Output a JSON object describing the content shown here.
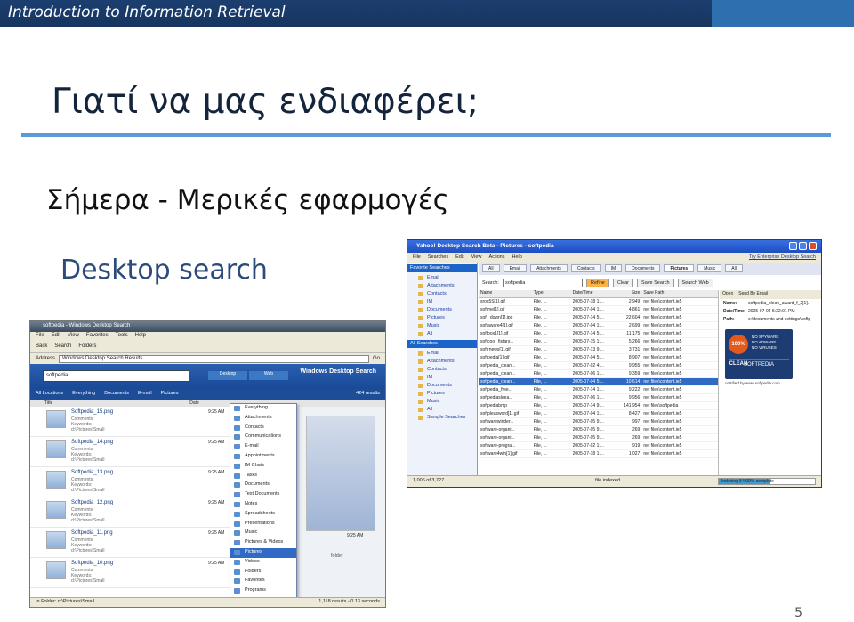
{
  "header": {
    "course_title": "Introduction to Information Retrieval"
  },
  "slide": {
    "title": "Γιατί να μας ενδιαφέρει;",
    "bullet1": "Σήμερα - Μερικές εφαρμογές",
    "bullet2": "Desktop search",
    "page_number": "5"
  },
  "windows_desktop_search": {
    "window_title": "softpedia - Windows Desktop Search",
    "menu": [
      "File",
      "Edit",
      "View",
      "Favorites",
      "Tools",
      "Help"
    ],
    "toolbar": [
      "Back",
      "Search",
      "Folders"
    ],
    "address_label": "Address",
    "address_value": "Windows Desktop Search Results",
    "address_go": "Go",
    "query": "softpedia",
    "scope_buttons": [
      "Desktop",
      "Web"
    ],
    "logo": "Windows Desktop Search",
    "filters": [
      "All Locations",
      "Everything",
      "Documents",
      "E-mail",
      "Pictures"
    ],
    "result_count": "424 results",
    "columns": [
      "Title",
      "Date"
    ],
    "results": [
      {
        "name": "Softpedia_15.png",
        "comments": "Comments:",
        "keywords": "Keywords:",
        "path": "d:\\Pictures\\Small",
        "date": "9:25 AM"
      },
      {
        "name": "Softpedia_14.png",
        "comments": "Comments:",
        "keywords": "Keywords:",
        "path": "d:\\Pictures\\Small",
        "date": "9:25 AM"
      },
      {
        "name": "Softpedia_13.png",
        "comments": "Comments:",
        "keywords": "Keywords:",
        "path": "d:\\Pictures\\Small",
        "date": "9:25 AM"
      },
      {
        "name": "Softpedia_12.png",
        "comments": "Comments:",
        "keywords": "Keywords:",
        "path": "d:\\Pictures\\Small",
        "date": "9:25 AM"
      },
      {
        "name": "Softpedia_11.png",
        "comments": "Comments:",
        "keywords": "Keywords:",
        "path": "d:\\Pictures\\Small",
        "date": "9:25 AM"
      },
      {
        "name": "Softpedia_10.png",
        "comments": "Comments:",
        "keywords": "Keywords:",
        "path": "d:\\Pictures\\Small",
        "date": "9:25 AM"
      }
    ],
    "dropdown": [
      "Everything",
      "Attachments",
      "Contacts",
      "Communications",
      "E-mail",
      "Appointments",
      "IM Chats",
      "Tasks",
      "Documents",
      "Text Documents",
      "Notes",
      "Spreadsheets",
      "Presentations",
      "Music",
      "Pictures & Videos",
      "Pictures",
      "Videos",
      "Folders",
      "Favorites",
      "Programs"
    ],
    "dropdown_selected": "Pictures",
    "preview_time": "9:25 AM",
    "preview_folder_label": "folder",
    "status_left": "In Folder: d:\\Pictures\\Small",
    "status_right": "1,118 results - 0.13 seconds"
  },
  "yahoo_desktop_search": {
    "window_title": "Yahoo! Desktop Search Beta - Pictures - softpedia",
    "menu": [
      "File",
      "Searches",
      "Edit",
      "View",
      "Actions",
      "Help"
    ],
    "enterprise_link": "Try Enterprise Desktop Search",
    "favorites_header": "Favorite Searches",
    "favorites": [
      "Email",
      "Attachments",
      "Contacts",
      "IM",
      "Documents",
      "Pictures",
      "Music",
      "All"
    ],
    "all_searches_header": "All Searches",
    "all_searches": [
      "Email",
      "Attachments",
      "Contacts",
      "IM",
      "Documents",
      "Pictures",
      "Music",
      "All",
      "Sample Searches"
    ],
    "type_tabs": [
      "All",
      "Email",
      "Attachments",
      "Contacts",
      "IM",
      "Documents",
      "Pictures",
      "Music",
      "All"
    ],
    "type_tab_selected": "Pictures",
    "search_label": "Search:",
    "search_value": "softpedia",
    "search_buttons": [
      "Refine",
      "Clear",
      "Save Search",
      "Search Web"
    ],
    "columns": [
      "Name",
      "Type",
      "Date/Time",
      "Size",
      "Save Path"
    ],
    "rows": [
      {
        "name": "sros5S[1].gif",
        "type": "File, ...",
        "date": "2005-07-18 1:...",
        "size": "2,949",
        "path": "net files\\content.ie5"
      },
      {
        "name": "softme[1].gif",
        "type": "File, ...",
        "date": "2005-07-04 1:...",
        "size": "4,861",
        "path": "net files\\content.ie5"
      },
      {
        "name": "soft_down[1].jpg",
        "type": "File, ...",
        "date": "2005-07-14 5:...",
        "size": "22,604",
        "path": "net files\\content.ie5"
      },
      {
        "name": "softaware4[1].gif",
        "type": "File, ...",
        "date": "2005-07-04 1:...",
        "size": "2,699",
        "path": "net files\\content.ie5"
      },
      {
        "name": "softbox1[1].gif",
        "type": "File, ...",
        "date": "2005-07-14 5:...",
        "size": "11,175",
        "path": "net files\\content.ie5"
      },
      {
        "name": "softcool_fistars...",
        "type": "File, ...",
        "date": "2005-07-15 1:...",
        "size": "5,266",
        "path": "net files\\content.ie5"
      },
      {
        "name": "softrnews[1].gif",
        "type": "File, ...",
        "date": "2005-07-13 9:...",
        "size": "3,731",
        "path": "net files\\content.ie5"
      },
      {
        "name": "softpedia[1].gif",
        "type": "File, ...",
        "date": "2005-07-04 5:...",
        "size": "8,907",
        "path": "net files\\content.ie5"
      },
      {
        "name": "softpedia_clean...",
        "type": "File, ...",
        "date": "2005-07-02 4:...",
        "size": "9,955",
        "path": "net files\\content.ie5"
      },
      {
        "name": "softpedia_clean...",
        "type": "File, ...",
        "date": "2005-07-06 1:...",
        "size": "9,359",
        "path": "net files\\content.ie5"
      },
      {
        "name": "softpedia_clean...",
        "type": "File, ...",
        "date": "2005-07-04 5:...",
        "size": "10,614",
        "path": "net files\\content.ie5"
      },
      {
        "name": "softpedia_free...",
        "type": "File, ...",
        "date": "2005-07-14 1:...",
        "size": "9,222",
        "path": "net files\\content.ie5"
      },
      {
        "name": "softpediasleea...",
        "type": "File, ...",
        "date": "2005-07-06 1:...",
        "size": "9,956",
        "path": "net files\\content.ie5"
      },
      {
        "name": "softpediabmp",
        "type": "File, ...",
        "date": "2005-07-14 9:...",
        "size": "141,954",
        "path": "net files\\softpedia"
      },
      {
        "name": "softpleasword[1].gif",
        "type": "File, ...",
        "date": "2005-07-04 1:...",
        "size": "8,427",
        "path": "net files\\content.ie5"
      },
      {
        "name": "softwarewinder...",
        "type": "File, ...",
        "date": "2005-07-05 9:...",
        "size": "997",
        "path": "net files\\content.ie5"
      },
      {
        "name": "software-organi...",
        "type": "File, ...",
        "date": "2005-07-05 9:...",
        "size": "269",
        "path": "net files\\content.ie5"
      },
      {
        "name": "software-organi...",
        "type": "File, ...",
        "date": "2005-07-05 9:...",
        "size": "269",
        "path": "net files\\content.ie5"
      },
      {
        "name": "software-progra...",
        "type": "File, ...",
        "date": "2005-07-02 1:...",
        "size": "919",
        "path": "net files\\content.ie5"
      },
      {
        "name": "software4win[1].gif",
        "type": "File, ...",
        "date": "2005-07-18 1:...",
        "size": "1,027",
        "path": "net files\\content.ie5"
      }
    ],
    "highlighted_row_index": 10,
    "detail_actions": [
      "Open",
      "Send By Email"
    ],
    "detail": [
      {
        "key": "Name:",
        "value": "softpedia_clean_award_f_2[1]."
      },
      {
        "key": "Date/Time:",
        "value": "2005-07-04 5:32:01 PM"
      },
      {
        "key": "Path:",
        "value": "c:\\documents and settings\\softp"
      }
    ],
    "badge": {
      "seal": "100% CLEAN",
      "lines": [
        "NO SPYWARE",
        "NO ADWARE",
        "NO VIRUSES"
      ],
      "brand": "SOFTPEDIA",
      "caption": "certified by www.softpedia.com"
    },
    "status_left": "1,006 of 3,727",
    "status_middle": "file indexed",
    "progress_label": "Indexing 54.09% complete",
    "progress_fraction": 0.54
  }
}
